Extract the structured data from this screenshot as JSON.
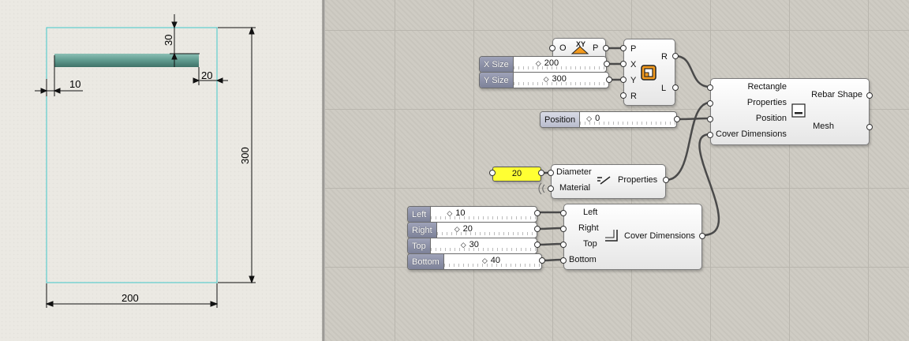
{
  "drawing": {
    "dim_top": "30",
    "dim_left": "10",
    "dim_right": "20",
    "dim_height": "300",
    "dim_width": "200"
  },
  "point_component": {
    "in_label": "O",
    "out_label": "P",
    "icon_text": "XY"
  },
  "rectangle_component": {
    "inputs": [
      "P",
      "X",
      "Y",
      "R"
    ],
    "outputs": [
      "R",
      "L"
    ]
  },
  "sliders": {
    "x_size": {
      "label": "X Size",
      "value": "200"
    },
    "y_size": {
      "label": "Y Size",
      "value": "300"
    },
    "position": {
      "label": "Position",
      "value": "0"
    },
    "left": {
      "label": "Left",
      "value": "10"
    },
    "right": {
      "label": "Right",
      "value": "20"
    },
    "top": {
      "label": "Top",
      "value": "30"
    },
    "bottom": {
      "label": "Bottom",
      "value": "40"
    }
  },
  "panel": {
    "value": "20"
  },
  "rebar_component": {
    "inputs": [
      "Rectangle",
      "Properties",
      "Position",
      "Cover Dimensions"
    ],
    "outputs": [
      "Rebar Shape",
      "Mesh"
    ]
  },
  "properties_component": {
    "inputs": [
      "Diameter",
      "Material"
    ],
    "title": "Properties"
  },
  "cover_component": {
    "inputs": [
      "Left",
      "Right",
      "Top",
      "Bottom"
    ],
    "title": "Cover Dimensions"
  },
  "colors": {
    "rebar": "#5f9a8e",
    "section_outline": "#40c8c8",
    "panel": "#ffff33",
    "icon_orange": "#f39a1e"
  }
}
